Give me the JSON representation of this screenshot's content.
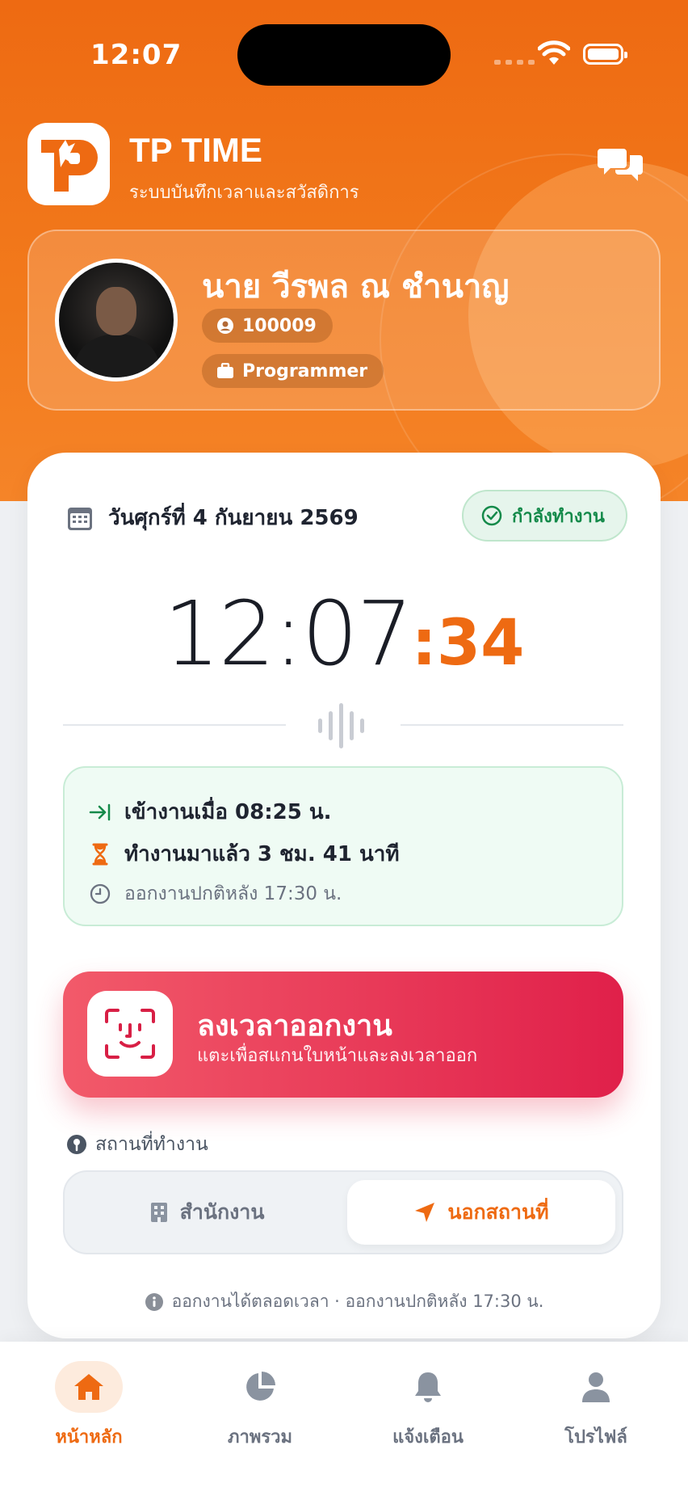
{
  "status_bar": {
    "time": "12:07"
  },
  "brand": {
    "title": "TP TIME",
    "subtitle": "ระบบบันทึกเวลาและสวัสดิการ"
  },
  "profile": {
    "name": "นาย วีรพล ณ ชำนาญ",
    "employee_id": "100009",
    "position": "Programmer"
  },
  "today": {
    "date": "วันศุกร์ที่ 4 กันยายน 2569",
    "status_badge": "กำลังทำงาน",
    "clock_hm": "12:07",
    "clock_sec": ":34"
  },
  "work_info": {
    "checkin": "เข้างานเมื่อ 08:25 น.",
    "worked": "ทำงานมาแล้ว 3 ชม. 41 นาที",
    "normal_out": "ออกงานปกติหลัง 17:30 น."
  },
  "checkout_button": {
    "title": "ลงเวลาออกงาน",
    "subtitle": "แตะเพื่อสแกนใบหน้าและลงเวลาออก"
  },
  "location": {
    "label": "สถานที่ทำงาน",
    "options": [
      "สำนักงาน",
      "นอกสถานที่"
    ],
    "selected": "นอกสถานที่"
  },
  "footnote": "ออกงานได้ตลอดเวลา · ออกงานปกติหลัง 17:30 น.",
  "nav": {
    "items": [
      {
        "label": "หน้าหลัก",
        "icon": "home-icon"
      },
      {
        "label": "ภาพรวม",
        "icon": "pie-chart-icon"
      },
      {
        "label": "แจ้งเตือน",
        "icon": "bell-icon"
      },
      {
        "label": "โปรไฟล์",
        "icon": "user-icon"
      }
    ],
    "active": "หน้าหลัก"
  },
  "colors": {
    "brand_orange": "#ee6a12",
    "checkout_red": "#e0204a",
    "working_green": "#148a4a"
  }
}
